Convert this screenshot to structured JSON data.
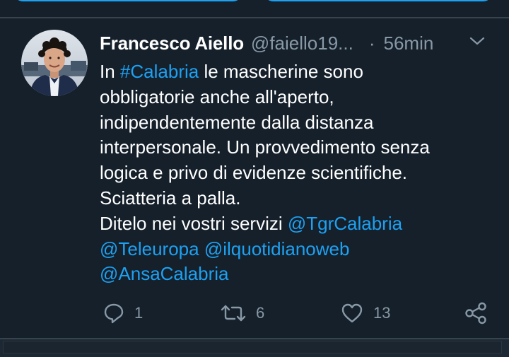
{
  "tweet": {
    "author_name": "Francesco Aiello",
    "author_handle": "@faiello19...",
    "separator": "·",
    "timestamp": "56min",
    "lines": [
      [
        {
          "text": "In "
        },
        {
          "text": "#Calabria",
          "link": true
        },
        {
          "text": " le mascherine sono"
        }
      ],
      [
        {
          "text": "obbligatorie anche all'aperto,"
        }
      ],
      [
        {
          "text": "indipendentemente dalla distanza"
        }
      ],
      [
        {
          "text": "interpersonale. Un provvedimento senza"
        }
      ],
      [
        {
          "text": "logica e privo di evidenze scientifiche."
        }
      ],
      [
        {
          "text": "Sciatteria a palla."
        }
      ],
      [
        {
          "text": "Ditelo nei vostri servizi "
        },
        {
          "text": "@TgrCalabria",
          "link": true
        }
      ],
      [
        {
          "text": "@Teleuropa",
          "link": true
        },
        {
          "text": " "
        },
        {
          "text": "@ilquotidianoweb",
          "link": true
        }
      ],
      [
        {
          "text": "@AnsaCalabria",
          "link": true
        }
      ]
    ]
  },
  "actions": {
    "reply_count": "1",
    "retweet_count": "6",
    "like_count": "13"
  },
  "icons": {
    "reply": "reply-icon",
    "retweet": "retweet-icon",
    "like": "heart-icon",
    "share": "share-icon",
    "menu": "chevron-down-icon"
  },
  "colors": {
    "background": "#15202b",
    "accent": "#1da1f2",
    "text": "#ffffff",
    "muted": "#8899a6",
    "divider": "#38444d"
  }
}
